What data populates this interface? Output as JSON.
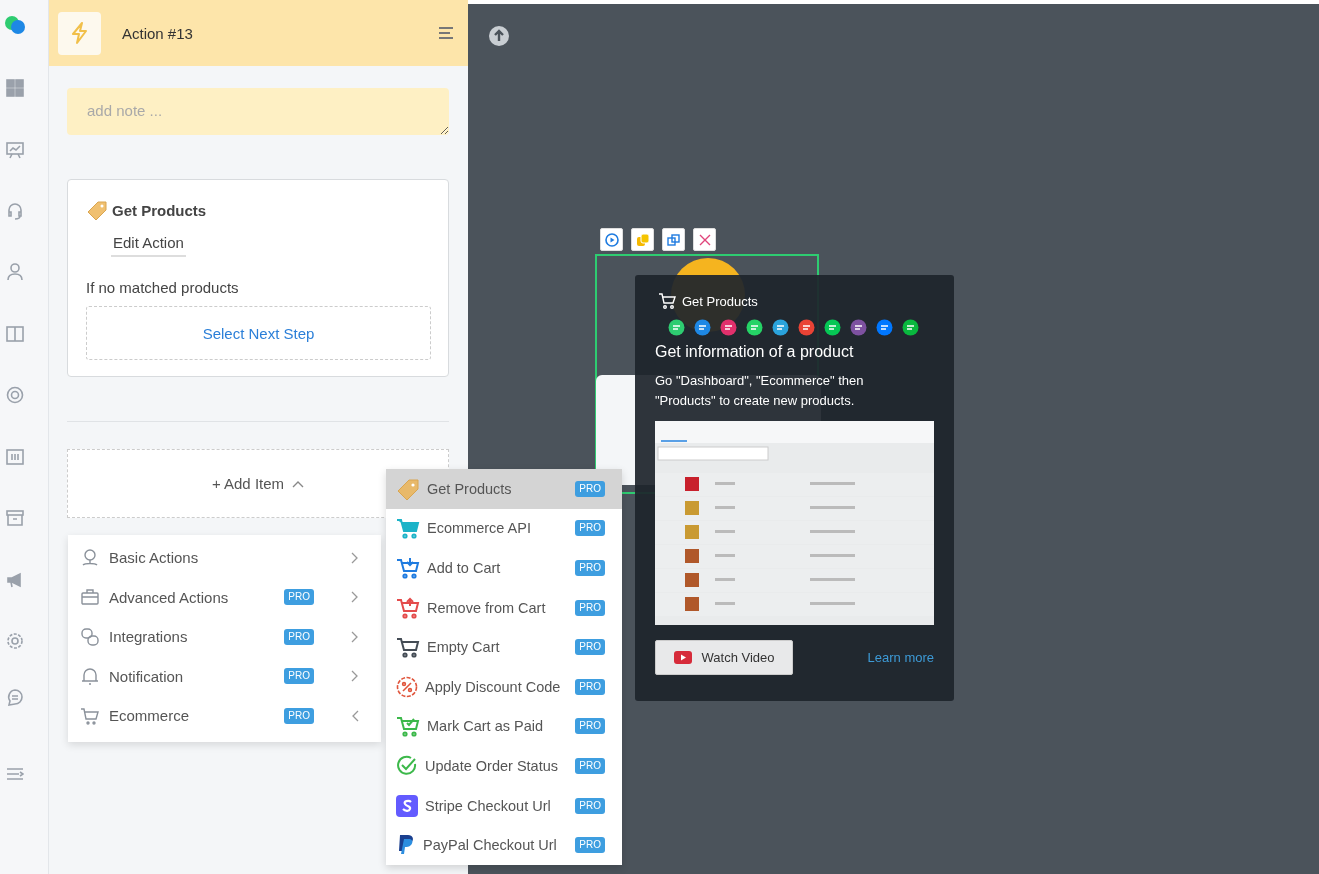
{
  "panel": {
    "title": "Action #13",
    "note": {
      "placeholder": "add note ..."
    },
    "card": {
      "title": "Get Products",
      "edit_link": "Edit Action",
      "fallback_label": "If no matched products",
      "next_step": "Select Next Step"
    },
    "add_item": "+ Add Item"
  },
  "menu": {
    "items": [
      {
        "label": "Basic Actions",
        "kind": "pin",
        "expanded": false
      },
      {
        "label": "Advanced Actions",
        "kind": "briefcase",
        "badge": "PRO",
        "expanded": false
      },
      {
        "label": "Integrations",
        "kind": "link",
        "badge": "PRO",
        "expanded": false
      },
      {
        "label": "Notification",
        "kind": "bell",
        "badge": "PRO",
        "expanded": false
      },
      {
        "label": "Ecommerce",
        "kind": "cart",
        "badge": "PRO",
        "expanded": true
      }
    ]
  },
  "submenu": {
    "items": [
      {
        "label": "Get Products",
        "kind": "tag",
        "badge": "PRO",
        "selected": true
      },
      {
        "label": "Ecommerce API",
        "kind": "cart-api",
        "badge": "PRO",
        "selected": false
      },
      {
        "label": "Add to Cart",
        "kind": "cart-add",
        "badge": "PRO",
        "selected": false
      },
      {
        "label": "Remove from Cart",
        "kind": "cart-remove",
        "badge": "PRO",
        "selected": false
      },
      {
        "label": "Empty Cart",
        "kind": "cart-empty",
        "badge": "PRO",
        "selected": false
      },
      {
        "label": "Apply Discount Code",
        "kind": "discount",
        "badge": "PRO",
        "selected": false
      },
      {
        "label": "Mark Cart as Paid",
        "kind": "cart-paid",
        "badge": "PRO",
        "selected": false
      },
      {
        "label": "Update Order Status",
        "kind": "check",
        "badge": "PRO",
        "selected": false
      },
      {
        "label": "Stripe Checkout Url",
        "kind": "stripe",
        "badge": "PRO",
        "selected": false
      },
      {
        "label": "PayPal Checkout Url",
        "kind": "paypal",
        "badge": "PRO",
        "selected": false
      }
    ]
  },
  "tooltip": {
    "title": "Get Products",
    "heading": "Get information of a product",
    "text": "Go \"Dashboard\", \"Ecommerce\" then \"Products\" to create new products.",
    "video_button": "Watch Video",
    "link": "Learn more"
  }
}
